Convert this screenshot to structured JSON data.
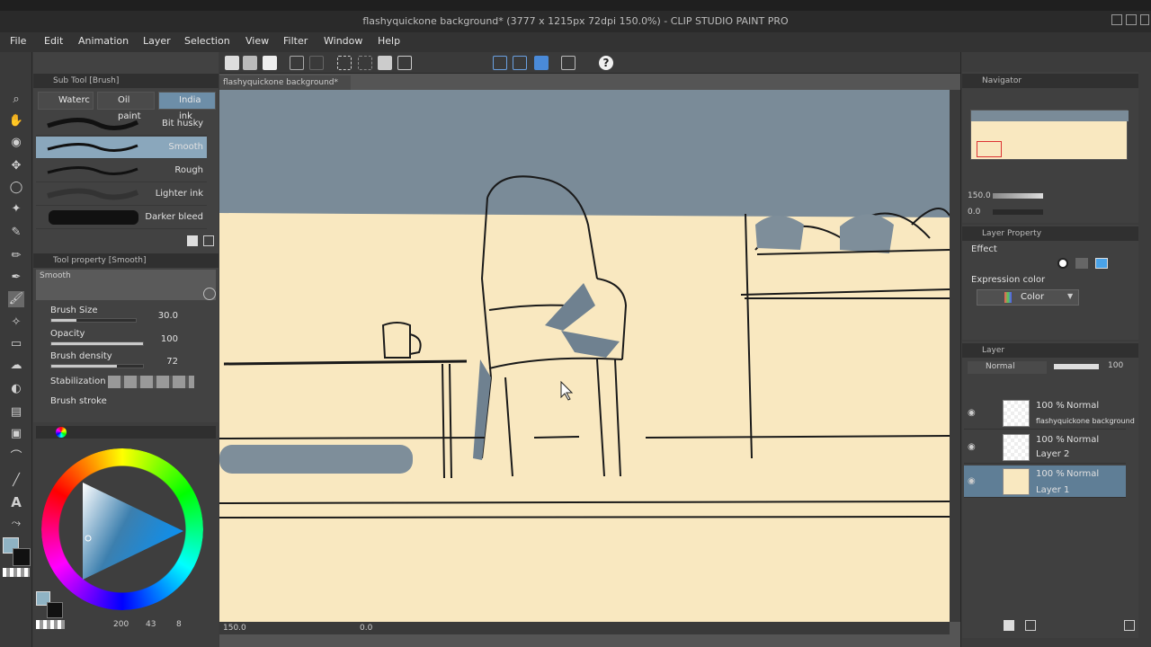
{
  "window": {
    "title": "flashyquickone background* (3777 x 1215px 72dpi 150.0%) - CLIP STUDIO PAINT PRO"
  },
  "menu": [
    "File",
    "Edit",
    "Animation",
    "Layer",
    "Selection",
    "View",
    "Filter",
    "Window",
    "Help"
  ],
  "document_tab": "flashyquickone background*",
  "sub_tool": {
    "header": "Sub Tool [Brush]",
    "tabs": [
      "Waterc",
      "Oil paint",
      "India ink"
    ],
    "active_tab": 2,
    "brushes": [
      "Bit husky",
      "Smooth",
      "Rough",
      "Lighter ink",
      "Darker bleed"
    ],
    "selected_brush": 1
  },
  "tool_property": {
    "header": "Tool property [Smooth]",
    "preview_label": "Smooth",
    "brush_size_label": "Brush Size",
    "brush_size": "30.0",
    "brush_size_level": 0.3,
    "opacity_label": "Opacity",
    "opacity": "100",
    "opacity_level": 1.0,
    "density_label": "Brush density",
    "density": "72",
    "density_level": 0.72,
    "stabilization_label": "Stabilization",
    "brush_stroke_label": "Brush stroke"
  },
  "color_panel": {
    "main_color": "#8fb3c4",
    "sub_color": "#111111"
  },
  "status": {
    "zoom_left": "150.0",
    "angle": "0.0",
    "bottom_nums": [
      "200",
      "43",
      "8"
    ]
  },
  "navigator": {
    "header": "Navigator",
    "zoom": "150.0",
    "angle": "0.0"
  },
  "layer_property": {
    "header": "Layer Property",
    "effect_label": "Effect",
    "expression_color_label": "Expression color",
    "expression_color_value": "Color"
  },
  "layer_panel": {
    "header": "Layer",
    "blend_mode": "Normal",
    "opacity": "100",
    "layers": [
      {
        "pct": "100 %",
        "mode": "Normal",
        "name": "flashyquickone background"
      },
      {
        "pct": "100 %",
        "mode": "Normal",
        "name": "Layer 2"
      },
      {
        "pct": "100 %",
        "mode": "Normal",
        "name": "Layer 1"
      }
    ],
    "selected_layer": 2
  },
  "colors": {
    "canvas_bg": "#f9e8c0",
    "sky": "#7a8b98",
    "shadow": "#7e8e9a",
    "accent_blue": "#9cc3d8"
  }
}
